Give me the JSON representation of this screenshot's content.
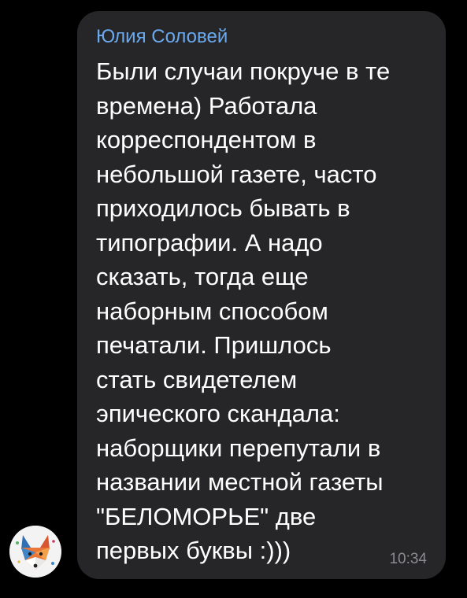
{
  "message": {
    "sender": "Юлия Соловей",
    "lines": [
      "Были случаи покруче в те",
      "времена) Работала",
      "корреспондентом в",
      "небольшой газете, часто",
      "приходилось бывать в",
      "типографии. А надо",
      "сказать, тогда еще",
      "наборным способом",
      "печатали. Пришлось",
      "стать свидетелем",
      "эпического скандала:",
      "наборщики перепутали в",
      "названии местной газеты",
      "\"БЕЛОМОРЬЕ\" две",
      "первых буквы :)))"
    ],
    "time": "10:34"
  },
  "avatar": {
    "icon": "fox-avatar-icon"
  },
  "colors": {
    "background": "#000000",
    "bubble": "#262628",
    "sender": "#6aa9ee",
    "text": "#ffffff",
    "time": "#8c8c90"
  }
}
